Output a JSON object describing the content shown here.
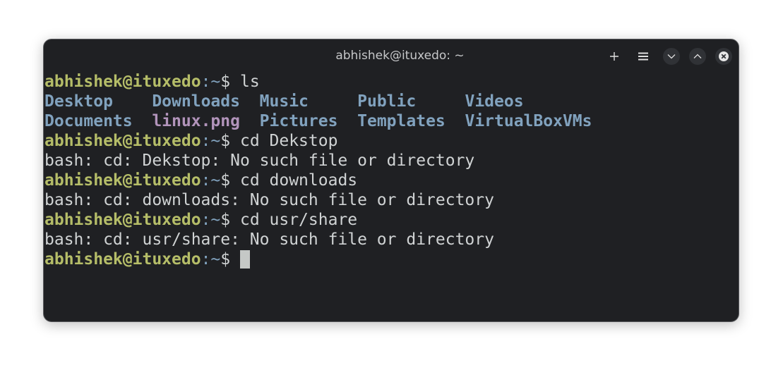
{
  "window": {
    "title": "abhishek@ituxedo: ~",
    "buttons": {
      "new_tab": "+",
      "menu": "≡",
      "minimize": "minimize",
      "maximize": "maximize",
      "close": "close"
    }
  },
  "prompt": {
    "user_host": "abhishek@ituxedo",
    "path": ":~",
    "sign": "$ "
  },
  "session": [
    {
      "type": "command",
      "text": "ls"
    },
    {
      "type": "ls_output",
      "rows": [
        [
          {
            "name": "Desktop",
            "kind": "dir",
            "cell": "Desktop    "
          },
          {
            "name": "Downloads",
            "kind": "dir",
            "cell": "Downloads  "
          },
          {
            "name": "Music",
            "kind": "dir",
            "cell": "Music     "
          },
          {
            "name": "Public",
            "kind": "dir",
            "cell": "Public     "
          },
          {
            "name": "Videos",
            "kind": "dir",
            "cell": "Videos"
          }
        ],
        [
          {
            "name": "Documents",
            "kind": "dir",
            "cell": "Documents  "
          },
          {
            "name": "linux.png",
            "kind": "image",
            "cell": "linux.png  "
          },
          {
            "name": "Pictures",
            "kind": "dir",
            "cell": "Pictures  "
          },
          {
            "name": "Templates",
            "kind": "dir",
            "cell": "Templates  "
          },
          {
            "name": "VirtualBoxVMs",
            "kind": "dir",
            "cell": "VirtualBoxVMs"
          }
        ]
      ]
    },
    {
      "type": "command",
      "text": "cd Dekstop"
    },
    {
      "type": "output",
      "text": "bash: cd: Dekstop: No such file or directory"
    },
    {
      "type": "command",
      "text": "cd downloads"
    },
    {
      "type": "output",
      "text": "bash: cd: downloads: No such file or directory"
    },
    {
      "type": "command",
      "text": "cd usr/share"
    },
    {
      "type": "output",
      "text": "bash: cd: usr/share: No such file or directory"
    },
    {
      "type": "command",
      "text": "",
      "cursor": true
    }
  ],
  "colors": {
    "background": "#1f2023",
    "prompt_user": "#b5bd68",
    "prompt_path": "#81a2be",
    "directory": "#81a2be",
    "image_file": "#b294bb",
    "text": "#d0d3d4"
  }
}
